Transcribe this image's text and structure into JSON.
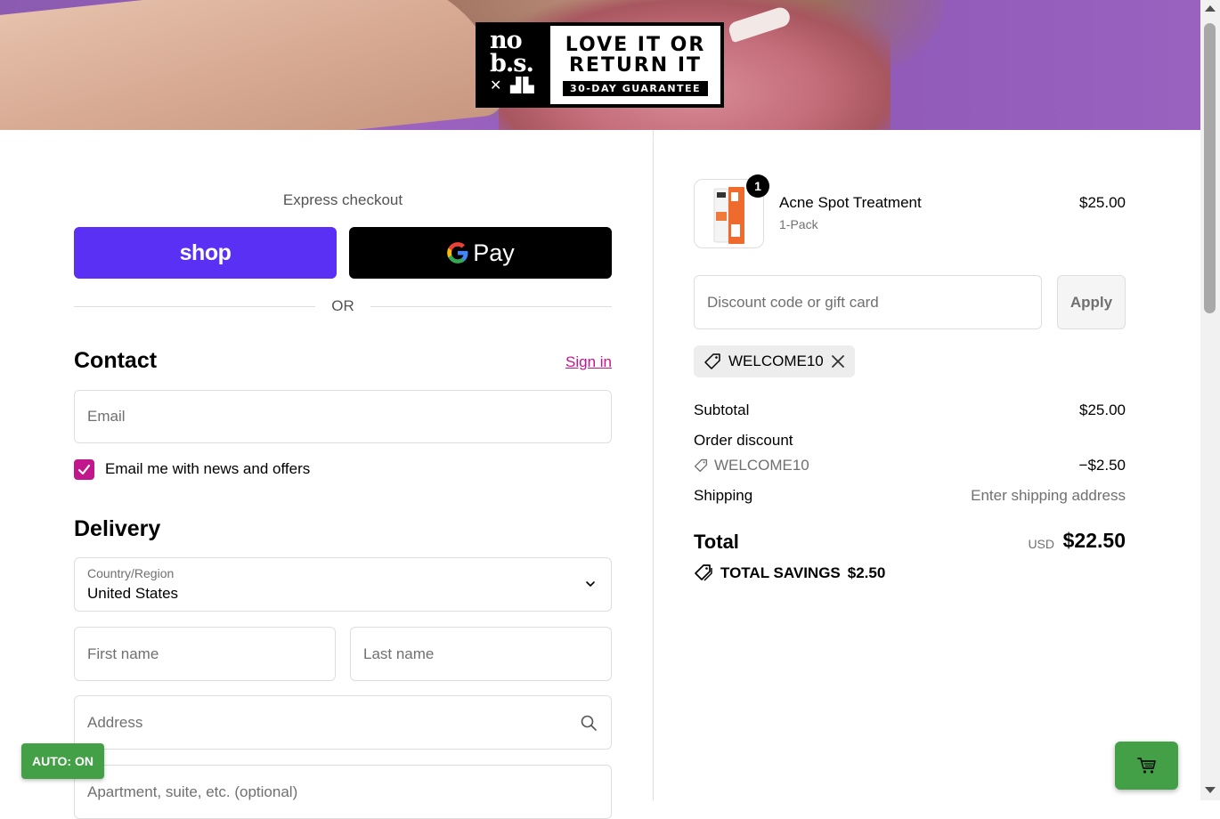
{
  "banner": {
    "logo_line1": "no",
    "logo_line2": "b.s.",
    "guarantee_line1": "LOVE IT OR",
    "guarantee_line2": "RETURN IT",
    "guarantee_sub": "30-DAY GUARANTEE"
  },
  "express": {
    "label": "Express checkout",
    "shop_label": "shop",
    "gpay_label": "Pay",
    "or_label": "OR"
  },
  "contact": {
    "heading": "Contact",
    "signin_label": "Sign in",
    "email_placeholder": "Email",
    "newsletter_label": "Email me with news and offers",
    "newsletter_checked": true
  },
  "delivery": {
    "heading": "Delivery",
    "country_label": "Country/Region",
    "country_value": "United States",
    "first_name_placeholder": "First name",
    "last_name_placeholder": "Last name",
    "address_placeholder": "Address",
    "apartment_placeholder": "Apartment, suite, etc. (optional)"
  },
  "summary": {
    "product": {
      "name": "Acne Spot Treatment",
      "variant": "1-Pack",
      "price": "$25.00",
      "quantity": "1"
    },
    "discount_placeholder": "Discount code or gift card",
    "apply_label": "Apply",
    "applied_code": "WELCOME10",
    "subtotal_label": "Subtotal",
    "subtotal_value": "$25.00",
    "order_discount_label": "Order discount",
    "discount_code": "WELCOME10",
    "discount_value": "−$2.50",
    "shipping_label": "Shipping",
    "shipping_value": "Enter shipping address",
    "total_label": "Total",
    "currency": "USD",
    "total_value": "$22.50",
    "savings_label": "TOTAL SAVINGS",
    "savings_value": "$2.50"
  },
  "overlay": {
    "auto_label": "AUTO: ON"
  },
  "colors": {
    "shop_pay": "#5a31f4",
    "accent": "#c2168c",
    "auto_green": "#43a047"
  }
}
